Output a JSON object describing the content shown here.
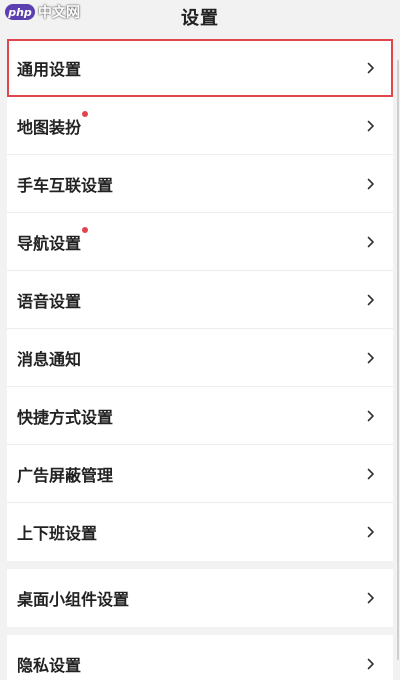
{
  "watermark": {
    "logo": "php",
    "text": "中文网"
  },
  "header": {
    "title": "设置"
  },
  "groups": [
    {
      "items": [
        {
          "label": "通用设置"
        },
        {
          "label": "地图装扮"
        },
        {
          "label": "手车互联设置"
        },
        {
          "label": "导航设置"
        },
        {
          "label": "语音设置"
        },
        {
          "label": "消息通知"
        },
        {
          "label": "快捷方式设置"
        },
        {
          "label": "广告屏蔽管理"
        },
        {
          "label": "上下班设置"
        }
      ]
    },
    {
      "items": [
        {
          "label": "桌面小组件设置"
        }
      ]
    },
    {
      "items": [
        {
          "label": "隐私设置"
        }
      ]
    }
  ],
  "colors": {
    "highlight_border": "#e0454b",
    "badge_dot": "#e0454b",
    "background": "#f2f2f2"
  },
  "icons": {
    "row_chevron": "chevron-right-icon",
    "badge": "red-dot-badge"
  }
}
